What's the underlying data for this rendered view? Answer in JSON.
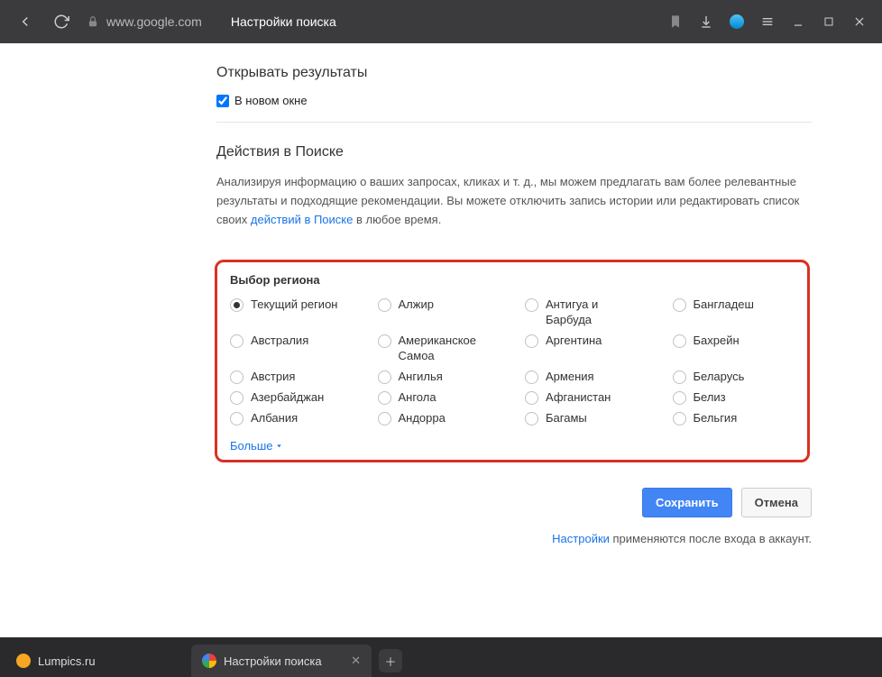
{
  "titlebar": {
    "url": "www.google.com",
    "title": "Настройки поиска"
  },
  "sections": {
    "open_results": {
      "title": "Открывать результаты",
      "checkbox_label": "В новом окне"
    },
    "search_actions": {
      "title": "Действия в Поиске",
      "desc_1": "Анализируя информацию о ваших запросах, кликах и т. д., мы можем предлагать вам более релевантные результаты и подходящие рекомендации. Вы можете отключить запись истории или редактировать список своих ",
      "link": "действий в Поиске",
      "desc_2": " в любое время."
    }
  },
  "region": {
    "title": "Выбор региона",
    "items": [
      {
        "label": "Текущий регион",
        "checked": true
      },
      {
        "label": "Алжир"
      },
      {
        "label": "Антигуа и Барбуда"
      },
      {
        "label": "Бангладеш"
      },
      {
        "label": "Австралия"
      },
      {
        "label": "Американское Самоа"
      },
      {
        "label": "Аргентина"
      },
      {
        "label": "Бахрейн"
      },
      {
        "label": "Австрия"
      },
      {
        "label": "Ангилья"
      },
      {
        "label": "Армения"
      },
      {
        "label": "Беларусь"
      },
      {
        "label": "Азербайджан"
      },
      {
        "label": "Ангола"
      },
      {
        "label": "Афганистан"
      },
      {
        "label": "Белиз"
      },
      {
        "label": "Албания"
      },
      {
        "label": "Андорра"
      },
      {
        "label": "Багамы"
      },
      {
        "label": "Бельгия"
      }
    ],
    "more": "Больше"
  },
  "buttons": {
    "save": "Сохранить",
    "cancel": "Отмена"
  },
  "footer": {
    "link": "Настройки",
    "text": " применяются после входа в аккаунт."
  },
  "tabs": [
    {
      "label": "Lumpics.ru",
      "favicon": "#f5a623"
    },
    {
      "label": "Настройки поиска",
      "favicon": "google"
    }
  ]
}
